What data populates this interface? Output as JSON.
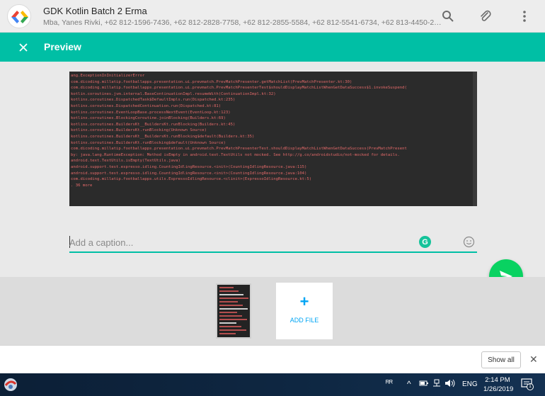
{
  "chat": {
    "title": "GDK Kotlin Batch 2 Erma",
    "subtitle": "Mba, Yanes Rivki, +62 812-1596-7436, +62 812-2828-7758, +62 812-2855-5584, +62 812-5541-6734, +62 813-4450-2292..."
  },
  "header_icons": [
    "search-icon",
    "paperclip-icon",
    "more-vert-icon"
  ],
  "preview": {
    "title": "Preview",
    "close_icon": "close-icon",
    "image_lines": [
      "ang.ExceptionInInitializerError",
      "com.dicoding.millatip.footballapps.presentation.ui.prevmatch.PrevMatchPresenter.getMatchList(PrevMatchPresenter.kt:30)",
      "com.dicoding.millatip.footballapps.presentation.ui.prevmatch.PrevMatchPresenterTest$shouldDisplayMatchListWhenGetDataSuccess$1.invokeSuspend(",
      "kotlin.coroutines.jvm.internal.BaseContinuationImpl.resumeWith(ContinuationImpl.kt:32)",
      "kotlinx.coroutines.DispatchedTask$DefaultImpls.run(Dispatched.kt:235)",
      "kotlinx.coroutines.DispatchedContinuation.run(Dispatched.kt:81)",
      "kotlinx.coroutines.EventLoopBase.processNextEvent(EventLoop.kt:123)",
      "kotlinx.coroutines.BlockingCoroutine.joinBlocking(Builders.kt:69)",
      "kotlinx.coroutines.BuildersKt__BuildersKt.runBlocking(Builders.kt:45)",
      "kotlinx.coroutines.BuildersKt.runBlocking(Unknown Source)",
      "kotlinx.coroutines.BuildersKt__BuildersKt.runBlocking$default(Builders.kt:35)",
      "kotlinx.coroutines.BuildersKt.runBlocking$default(Unknown Source)",
      "com.dicoding.millatip.footballapps.presentation.ui.prevmatch.PrevMatchPresenterTest.shouldDisplayMatchListWhenGetDataSuccess(PrevMatchPresent",
      "by: java.lang.RuntimeException: Method isEmpty in android.text.TextUtils not mocked. See http://g.co/androidstudio/not-mocked for details.",
      "android.text.TextUtils.isEmpty(TextUtils.java)",
      "android.support.test.espresso.idling.CountingIdlingResource.<init>(CountingIdlingResource.java:115)",
      "android.support.test.espresso.idling.CountingIdlingResource.<init>(CountingIdlingResource.java:104)",
      "com.dicoding.millatip.footballapps.utils.EspressoIdlingResource.<clinit>(EspressoIdlingResource.kt:5)",
      ". 36 more"
    ]
  },
  "caption": {
    "placeholder": "Add a caption...",
    "value": "",
    "grammarly_letter": "G",
    "emoji_icon": "smiley-icon"
  },
  "send": {
    "icon": "send-arrow-icon",
    "color": "#09d261"
  },
  "tray": {
    "add_file_label": "ADD FILE",
    "add_file_icon": "+"
  },
  "download_bar": {
    "show_all_label": "Show all",
    "close_label": "✕"
  },
  "taskbar": {
    "people_label": "ᴿᴿ",
    "language": "ENG",
    "time": "2:14 PM",
    "date": "1/26/2019",
    "notification_count": "1"
  },
  "colors": {
    "accent": "#00bfa5",
    "header_bg": "#ededed",
    "send_green": "#09d261",
    "link_blue": "#00a5f4"
  }
}
